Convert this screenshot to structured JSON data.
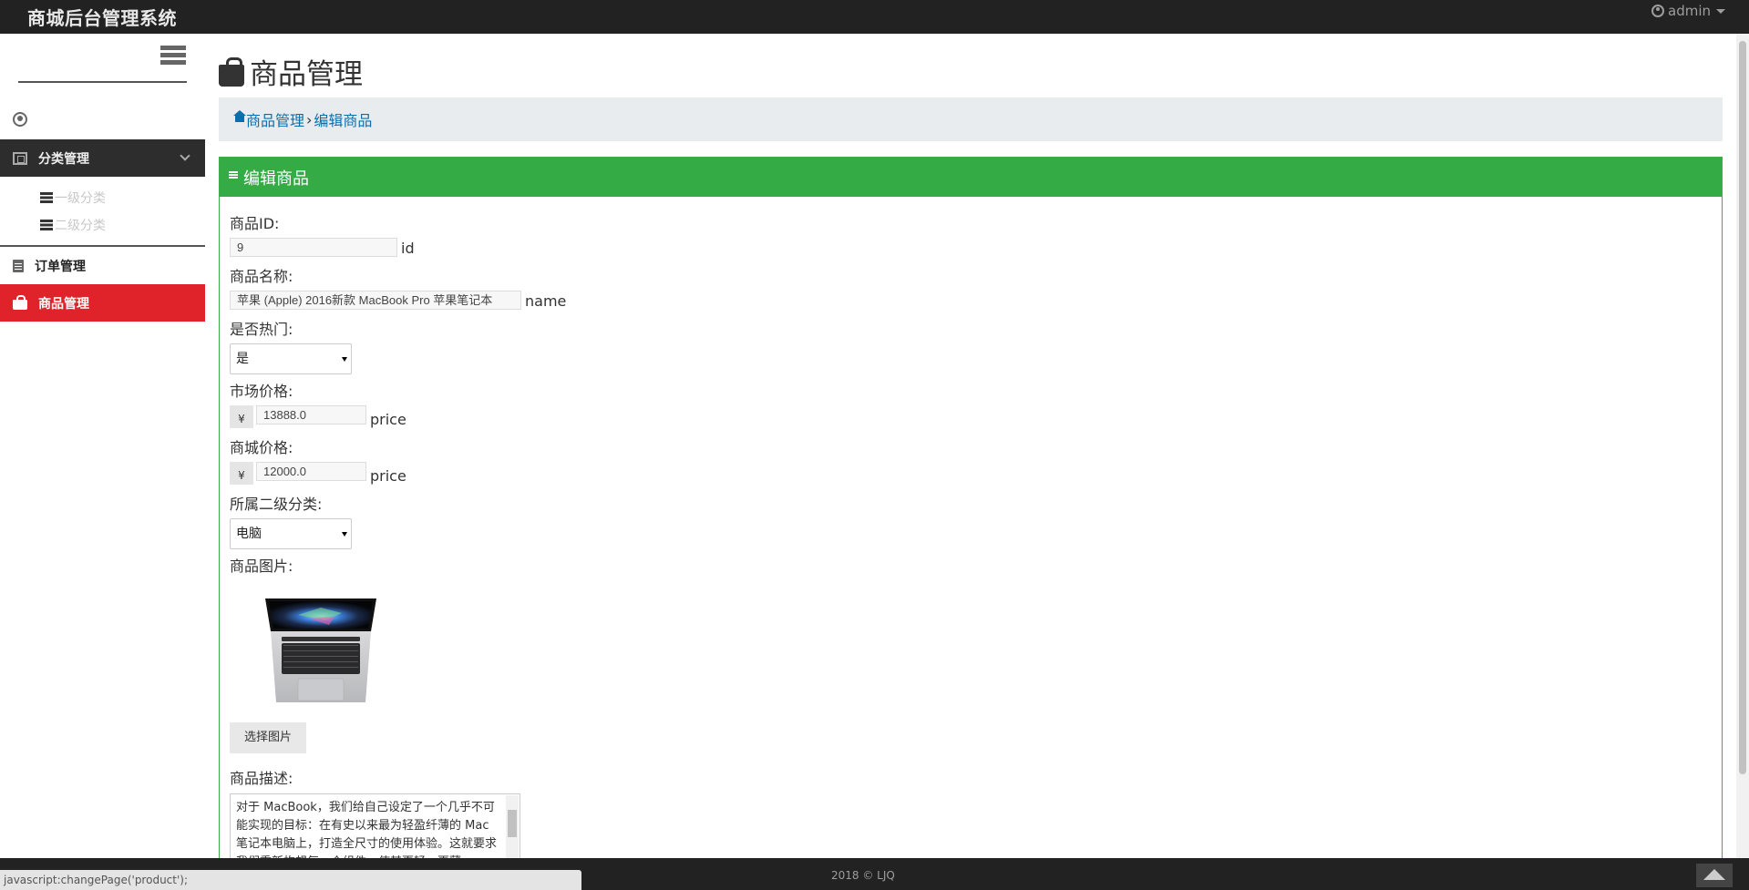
{
  "header": {
    "brand": "商城后台管理系统",
    "user": "admin"
  },
  "sidebar": {
    "items": [
      {
        "label": "分类管理",
        "icon": "category-icon",
        "state": "expanded"
      },
      {
        "label": "一级分类",
        "icon": "list-icon"
      },
      {
        "label": "二级分类",
        "icon": "list-icon"
      },
      {
        "label": "订单管理",
        "icon": "order-icon"
      },
      {
        "label": "商品管理",
        "icon": "shopping-bag-icon",
        "state": "active"
      }
    ]
  },
  "page": {
    "title": "商品管理"
  },
  "breadcrumb": {
    "home": "商品管理",
    "separator": "›",
    "current": "编辑商品"
  },
  "panel": {
    "title": "编辑商品"
  },
  "form": {
    "id_label": "商品ID:",
    "id_value": "9",
    "id_suffix": "id",
    "name_label": "商品名称:",
    "name_value": "苹果 (Apple)   2016新款 MacBook Pro 苹果笔记本",
    "name_suffix": "name",
    "hot_label": "是否热门:",
    "hot_value": "是",
    "market_price_label": "市场价格:",
    "currency": "¥",
    "market_price_value": "13888.0",
    "price_suffix": "price",
    "shop_price_label": "商城价格:",
    "shop_price_value": "12000.0",
    "category_label": "所属二级分类:",
    "category_value": "电脑",
    "image_label": "商品图片:",
    "choose_image_button": "选择图片",
    "desc_label": "商品描述:",
    "desc_value": "对于 MacBook，我们给自己设定了一个几乎不可能实现的目标：在有史以来最为轻盈纤薄的 Mac 笔记本电脑上，打造全尺寸的使用体验。这就要求我们重新构想每一个组件，使其更轻、更薄……"
  },
  "footer": {
    "copyright": "2018 © LJQ"
  },
  "status_bar": {
    "text": "javascript:changePage('product');"
  },
  "colors": {
    "topbar": "#222222",
    "active_menu": "#e0222a",
    "panel_green": "#35ab45",
    "link": "#0a6ead"
  }
}
